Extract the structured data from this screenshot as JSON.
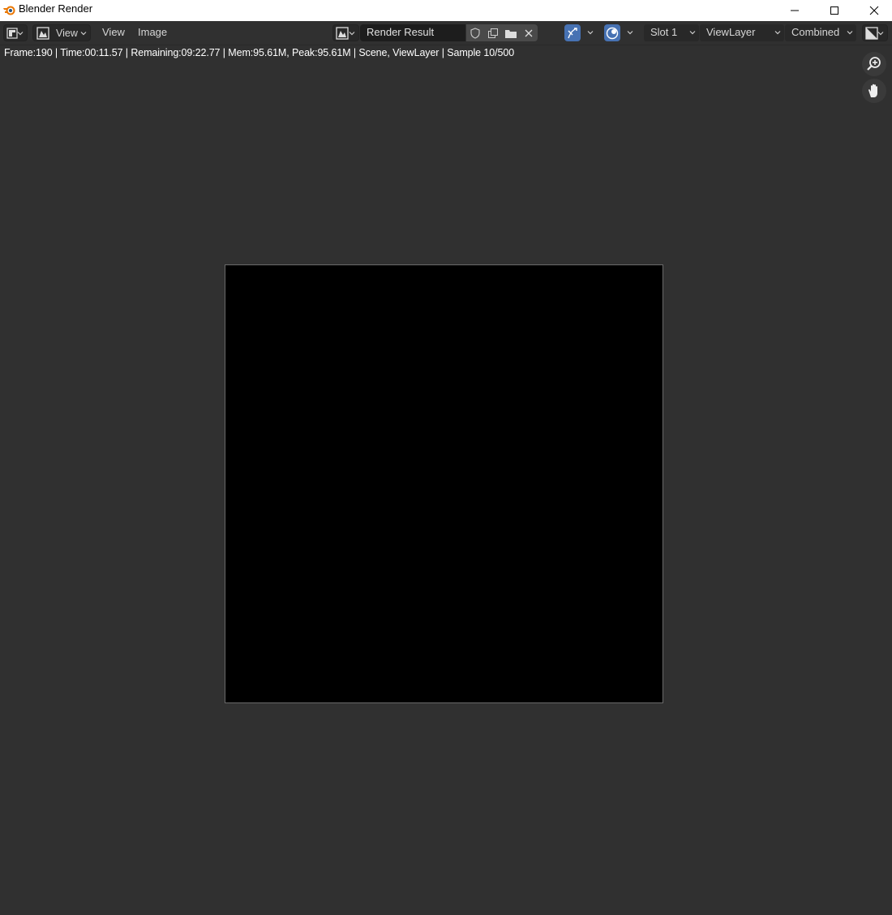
{
  "window": {
    "title": "Blender Render"
  },
  "header": {
    "menus": [
      "View",
      "Image"
    ],
    "view_dropdown_label": "View",
    "image_name": "Render Result",
    "slot": "Slot 1",
    "view_layer": "ViewLayer",
    "pass": "Combined"
  },
  "status": {
    "text": "Frame:190 | Time:00:11.57 | Remaining:09:22.77 | Mem:95.61M, Peak:95.61M | Scene, ViewLayer | Sample 10/500"
  },
  "colors": {
    "background": "#303030",
    "accent": "#4772b3",
    "render_area": "#000000"
  }
}
